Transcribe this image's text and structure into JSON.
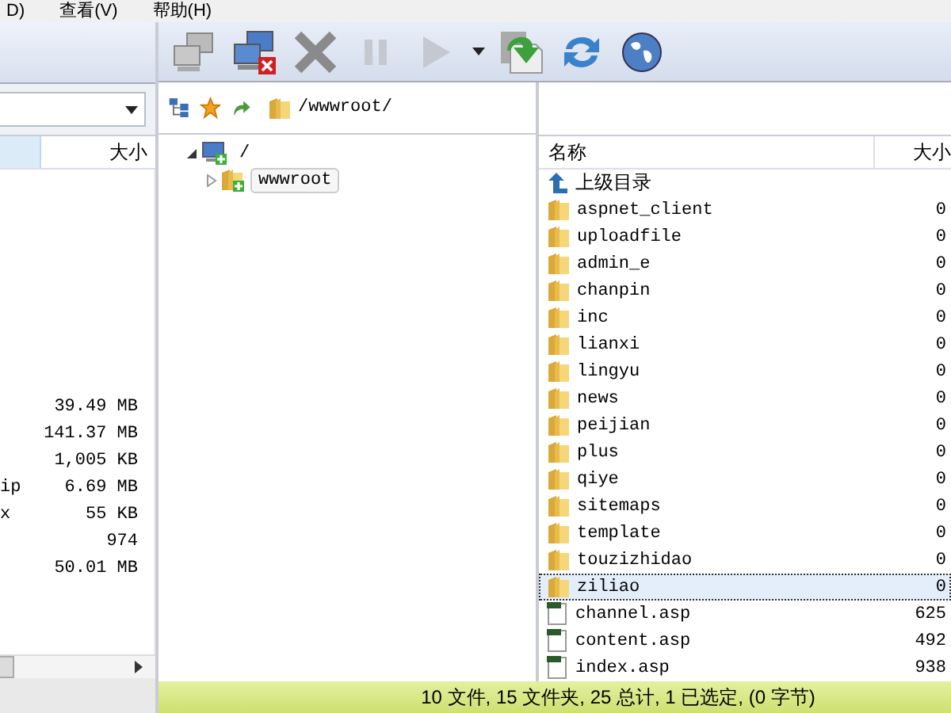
{
  "menu": [
    "D)",
    "查看(V)",
    "帮助(H)"
  ],
  "toolbar": [
    {
      "kind": "connect",
      "disabled": true
    },
    {
      "kind": "disconnect",
      "disabled": false
    },
    {
      "kind": "stop",
      "disabled": true
    },
    {
      "kind": "pause",
      "disabled": true
    },
    {
      "kind": "play",
      "disabled": true
    },
    {
      "kind": "dropdown",
      "disabled": false
    },
    {
      "kind": "download",
      "disabled": false
    },
    {
      "kind": "refresh",
      "disabled": false
    },
    {
      "kind": "globe",
      "disabled": false
    }
  ],
  "local_pane": {
    "columns": [
      "大小"
    ],
    "rows": [
      {
        "size": "39.49 MB"
      },
      {
        "size": "141.37 MB"
      },
      {
        "size": "1,005 KB"
      },
      {
        "name": "ip",
        "size": "6.69 MB"
      },
      {
        "name": "x",
        "size": "55 KB"
      },
      {
        "size": "974"
      },
      {
        "size": "50.01 MB"
      }
    ]
  },
  "remote_address": {
    "value": "/wwwroot/"
  },
  "tree": [
    {
      "label": "/",
      "expanded": true,
      "selected": false,
      "children": [
        {
          "label": "wwwroot",
          "expanded": false,
          "selected": true
        }
      ]
    }
  ],
  "remote_list": {
    "columns": [
      "名称",
      "大小"
    ],
    "rows": [
      {
        "kind": "parent",
        "name": "上级目录",
        "selected": false
      },
      {
        "kind": "folder",
        "name": "aspnet_client",
        "size": "0",
        "selected": false
      },
      {
        "kind": "folder",
        "name": "uploadfile",
        "size": "0",
        "selected": false
      },
      {
        "kind": "folder",
        "name": "admin_e",
        "size": "0",
        "selected": false
      },
      {
        "kind": "folder",
        "name": "chanpin",
        "size": "0",
        "selected": false
      },
      {
        "kind": "folder",
        "name": "inc",
        "size": "0",
        "selected": false
      },
      {
        "kind": "folder",
        "name": "lianxi",
        "size": "0",
        "selected": false
      },
      {
        "kind": "folder",
        "name": "lingyu",
        "size": "0",
        "selected": false
      },
      {
        "kind": "folder",
        "name": "news",
        "size": "0",
        "selected": false
      },
      {
        "kind": "folder",
        "name": "peijian",
        "size": "0",
        "selected": false
      },
      {
        "kind": "folder",
        "name": "plus",
        "size": "0",
        "selected": false
      },
      {
        "kind": "folder",
        "name": "qiye",
        "size": "0",
        "selected": false
      },
      {
        "kind": "folder",
        "name": "sitemaps",
        "size": "0",
        "selected": false
      },
      {
        "kind": "folder",
        "name": "template",
        "size": "0",
        "selected": false
      },
      {
        "kind": "folder",
        "name": "touzizhidao",
        "size": "0",
        "selected": false
      },
      {
        "kind": "folder",
        "name": "ziliao",
        "size": "0",
        "selected": true
      },
      {
        "kind": "file",
        "name": "channel.asp",
        "size": "625",
        "selected": false
      },
      {
        "kind": "file",
        "name": "content.asp",
        "size": "492",
        "selected": false
      },
      {
        "kind": "file",
        "name": "index.asp",
        "size": "938",
        "selected": false
      }
    ]
  },
  "status_bar": "10 文件, 15 文件夹, 25 总计, 1 已选定, (0 字节)"
}
